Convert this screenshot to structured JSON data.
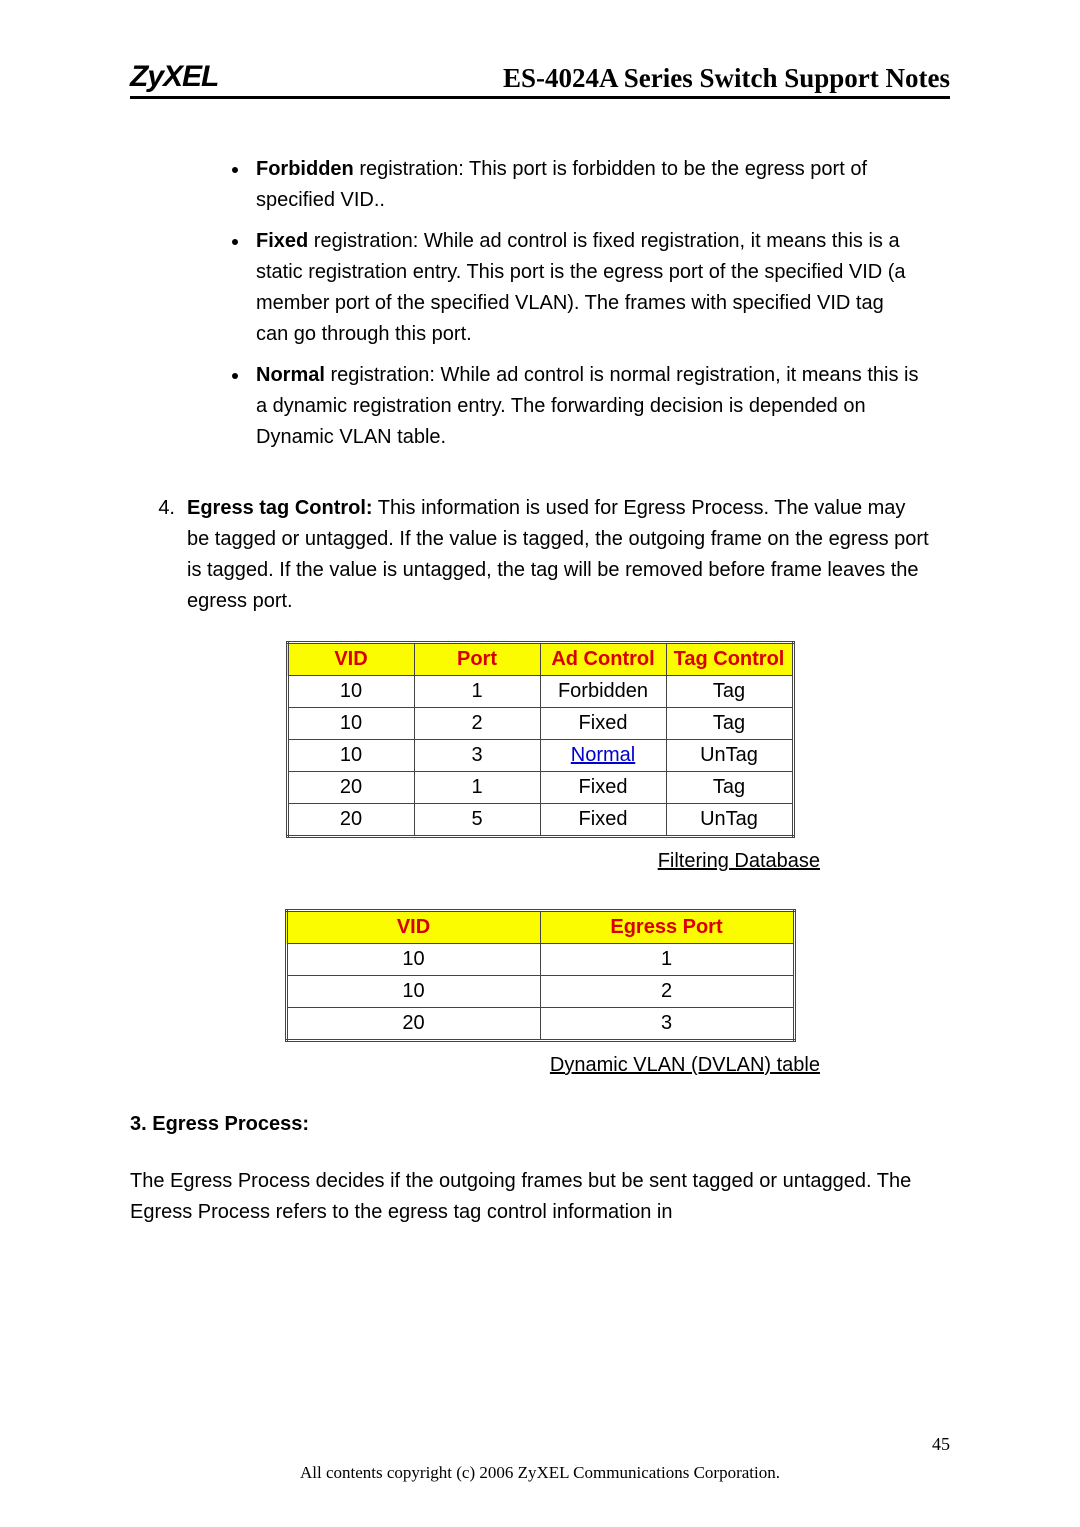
{
  "header": {
    "logo": "ZyXEL",
    "title": "ES-4024A Series Switch Support Notes"
  },
  "list3": {
    "items": [
      {
        "lead": "Forbidden",
        "rest": " registration: This port is forbidden to be the egress port of specified VID.."
      },
      {
        "lead": "Fixed",
        "rest": " registration: While ad control is fixed registration, it means this is a static registration entry. This port is the egress port of the specified VID (a member port of the specified VLAN). The frames with specified VID tag can go through this port."
      },
      {
        "lead": "Normal",
        "rest": " registration: While ad control is normal registration, it means this is a dynamic registration entry. The forwarding decision is depended on Dynamic VLAN table."
      }
    ]
  },
  "numbered": {
    "num": "4.",
    "lead": "Egress tag Control:",
    "rest": " This information is used for Egress Process. The value may be tagged or untagged. If the value is tagged, the outgoing frame on the egress port is tagged. If the value is untagged, the tag will be removed before frame leaves the egress port."
  },
  "table1": {
    "headers": [
      "VID",
      "Port",
      "Ad Control",
      "Tag Control"
    ],
    "rows": [
      {
        "vid": "10",
        "port": "1",
        "ad": "Forbidden",
        "ad_link": false,
        "tag": "Tag"
      },
      {
        "vid": "10",
        "port": "2",
        "ad": "Fixed",
        "ad_link": false,
        "tag": "Tag"
      },
      {
        "vid": "10",
        "port": "3",
        "ad": "Normal",
        "ad_link": true,
        "tag": "UnTag"
      },
      {
        "vid": "20",
        "port": "1",
        "ad": "Fixed",
        "ad_link": false,
        "tag": "Tag"
      },
      {
        "vid": "20",
        "port": "5",
        "ad": "Fixed",
        "ad_link": false,
        "tag": "UnTag"
      }
    ],
    "caption": " Filtering Database"
  },
  "table2": {
    "headers": [
      "VID",
      "Egress Port"
    ],
    "rows": [
      {
        "vid": "10",
        "ep": "1"
      },
      {
        "vid": "10",
        "ep": "2"
      },
      {
        "vid": "20",
        "ep": "3"
      }
    ],
    "caption": "Dynamic VLAN (DVLAN) table"
  },
  "section": {
    "heading": "3. Egress Process:",
    "para": "The Egress Process decides if the outgoing frames but be sent tagged or untagged. The Egress Process refers to the egress tag control information in"
  },
  "footer": {
    "page": "45",
    "copyright": "All contents copyright (c) 2006 ZyXEL Communications Corporation."
  }
}
